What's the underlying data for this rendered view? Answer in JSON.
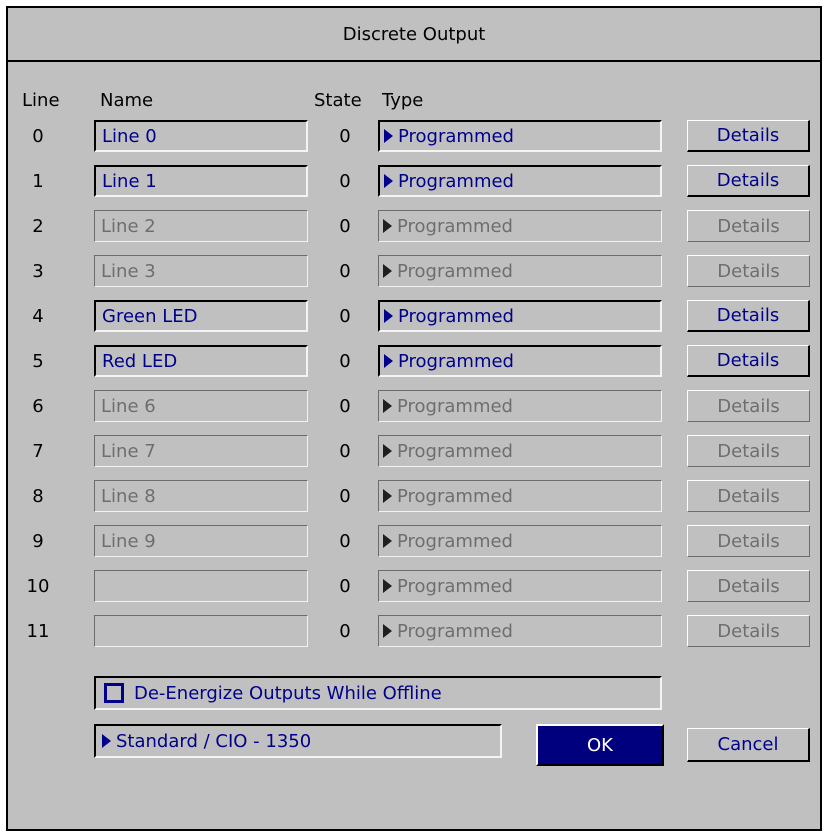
{
  "dialog": {
    "title": "Discrete Output"
  },
  "headers": {
    "line": "Line",
    "name": "Name",
    "state": "State",
    "type": "Type"
  },
  "rows": [
    {
      "line": "0",
      "name": "Line 0",
      "state": "0",
      "type": "Programmed",
      "details": "Details",
      "enabled": true
    },
    {
      "line": "1",
      "name": "Line 1",
      "state": "0",
      "type": "Programmed",
      "details": "Details",
      "enabled": true
    },
    {
      "line": "2",
      "name": "Line 2",
      "state": "0",
      "type": "Programmed",
      "details": "Details",
      "enabled": false
    },
    {
      "line": "3",
      "name": "Line 3",
      "state": "0",
      "type": "Programmed",
      "details": "Details",
      "enabled": false
    },
    {
      "line": "4",
      "name": "Green LED",
      "state": "0",
      "type": "Programmed",
      "details": "Details",
      "enabled": true
    },
    {
      "line": "5",
      "name": "Red LED",
      "state": "0",
      "type": "Programmed",
      "details": "Details",
      "enabled": true
    },
    {
      "line": "6",
      "name": "Line 6",
      "state": "0",
      "type": "Programmed",
      "details": "Details",
      "enabled": false
    },
    {
      "line": "7",
      "name": "Line 7",
      "state": "0",
      "type": "Programmed",
      "details": "Details",
      "enabled": false
    },
    {
      "line": "8",
      "name": "Line 8",
      "state": "0",
      "type": "Programmed",
      "details": "Details",
      "enabled": false
    },
    {
      "line": "9",
      "name": "Line 9",
      "state": "0",
      "type": "Programmed",
      "details": "Details",
      "enabled": false
    },
    {
      "line": "10",
      "name": "",
      "state": "0",
      "type": "Programmed",
      "details": "Details",
      "enabled": false
    },
    {
      "line": "11",
      "name": "",
      "state": "0",
      "type": "Programmed",
      "details": "Details",
      "enabled": false
    }
  ],
  "options": {
    "deenergize_label": "De-Energize Outputs While Offline",
    "deenergize_checked": false,
    "mode_value": "Standard / CIO - 1350"
  },
  "buttons": {
    "ok": "OK",
    "cancel": "Cancel"
  },
  "colors": {
    "enabled_text": "#00008b",
    "disabled_text": "#6e6e6e",
    "dialog_bg": "#c0c0c0",
    "ok_bg": "#00007f"
  }
}
